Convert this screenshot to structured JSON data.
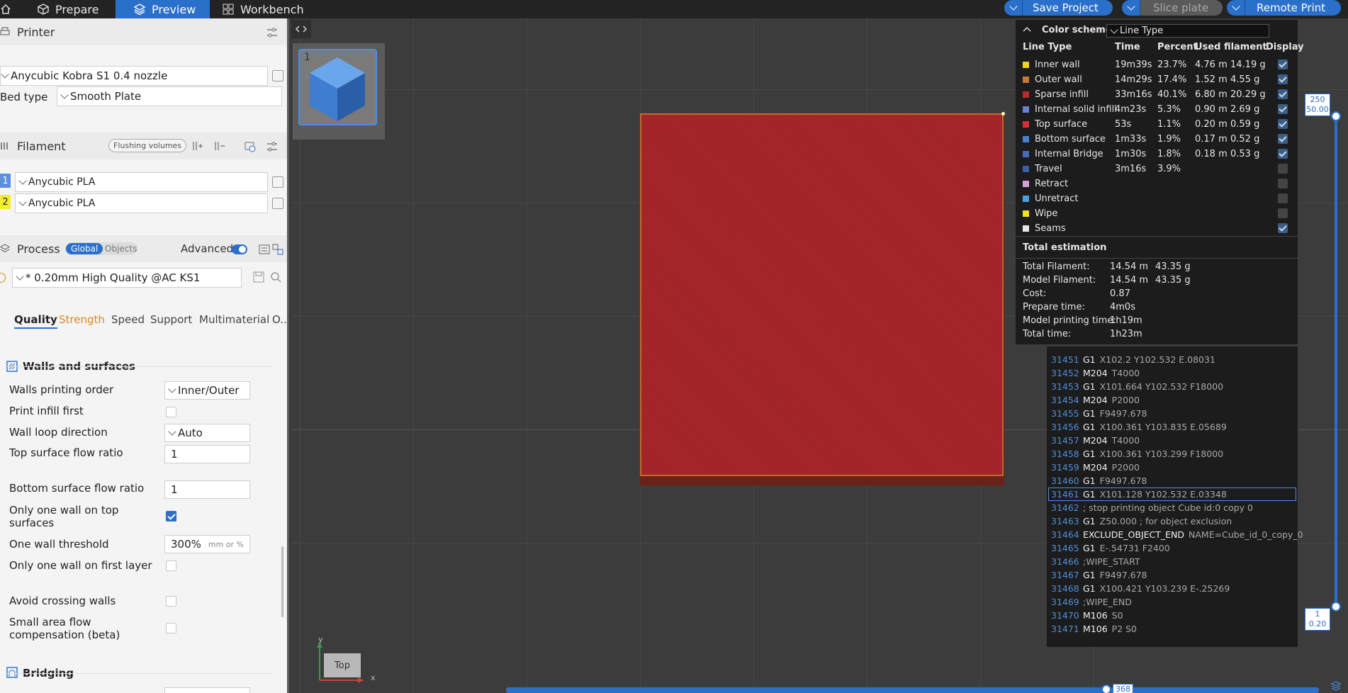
{
  "topbar": {
    "tabs": [
      {
        "label": "Prepare",
        "icon": "cube-outline-icon"
      },
      {
        "label": "Preview",
        "icon": "layers-icon",
        "active": true
      },
      {
        "label": "Workbench",
        "icon": "grid-icon"
      }
    ],
    "save_project": "Save Project",
    "slice_plate": "Slice plate",
    "remote_print": "Remote Print"
  },
  "printer": {
    "section": "Printer",
    "name": "Anycubic Kobra S1 0.4 nozzle",
    "bed_type_label": "Bed type",
    "bed_type": "Smooth Plate"
  },
  "filament": {
    "section": "Filament",
    "flushing": "Flushing volumes",
    "items": [
      {
        "index": "1",
        "name": "Anycubic PLA",
        "color": "#5b8fe0"
      },
      {
        "index": "2",
        "name": "Anycubic PLA",
        "color": "#f2ee2c"
      }
    ]
  },
  "process": {
    "section": "Process",
    "global": "Global",
    "objects": "Objects",
    "advanced": "Advanced",
    "preset": "* 0.20mm High Quality @AC KS1",
    "tabs": [
      "Quality",
      "Strength",
      "Speed",
      "Support",
      "Multimaterial",
      "O..."
    ],
    "group_walls": "Walls and surfaces",
    "settings": {
      "walls_printing_order": {
        "label": "Walls printing order",
        "value": "Inner/Outer"
      },
      "print_infill_first": {
        "label": "Print infill first",
        "checked": false
      },
      "wall_loop_direction": {
        "label": "Wall loop direction",
        "value": "Auto"
      },
      "top_surface_flow_ratio": {
        "label": "Top surface flow ratio",
        "value": "1"
      },
      "bottom_surface_flow_ratio": {
        "label": "Bottom surface flow ratio",
        "value": "1"
      },
      "only_one_wall_top": {
        "label1": "Only one wall on top",
        "label2": "surfaces",
        "checked": true
      },
      "one_wall_threshold": {
        "label": "One wall threshold",
        "value": "300%",
        "unit": "mm or %"
      },
      "only_one_wall_first": {
        "label": "Only one wall on first layer",
        "checked": false
      },
      "avoid_crossing_walls": {
        "label": "Avoid crossing walls",
        "checked": false
      },
      "small_area_flow": {
        "label1": "Small area flow",
        "label2": "compensation (beta)",
        "checked": false
      }
    },
    "group_bridging": "Bridging"
  },
  "viewport": {
    "plate_number": "1",
    "view_cube_label": "Top",
    "axis_x": "x",
    "axis_y": "y",
    "layer_top": {
      "layer": "250",
      "height": "50.00"
    },
    "layer_bottom": {
      "layer": "1",
      "height": "0.20"
    },
    "horizontal_slider_value": "368",
    "model_color": "#a8262a"
  },
  "legend": {
    "color_scheme_label": "Color scheme",
    "color_scheme_value": "Line Type",
    "headers": [
      "Line Type",
      "Time",
      "Percent",
      "Used filament",
      "Display"
    ],
    "rows": [
      {
        "name": "Inner wall",
        "color": "#f0d020",
        "time": "19m39s",
        "percent": "23.7%",
        "length": "4.76 m",
        "weight": "14.19 g",
        "display": true
      },
      {
        "name": "Outer wall",
        "color": "#c8783a",
        "time": "14m29s",
        "percent": "17.4%",
        "length": "1.52 m",
        "weight": "4.55 g",
        "display": true
      },
      {
        "name": "Sparse infill",
        "color": "#b82c2c",
        "time": "33m16s",
        "percent": "40.1%",
        "length": "6.80 m",
        "weight": "20.29 g",
        "display": true
      },
      {
        "name": "Internal solid infill",
        "color": "#6a7ed8",
        "time": "4m23s",
        "percent": "5.3%",
        "length": "0.90 m",
        "weight": "2.69 g",
        "display": true
      },
      {
        "name": "Top surface",
        "color": "#d83030",
        "time": "53s",
        "percent": "1.1%",
        "length": "0.20 m",
        "weight": "0.59 g",
        "display": true
      },
      {
        "name": "Bottom surface",
        "color": "#4c7fd0",
        "time": "1m33s",
        "percent": "1.9%",
        "length": "0.17 m",
        "weight": "0.52 g",
        "display": true
      },
      {
        "name": "Internal Bridge",
        "color": "#4a6ab8",
        "time": "1m30s",
        "percent": "1.8%",
        "length": "0.18 m",
        "weight": "0.53 g",
        "display": true
      },
      {
        "name": "Travel",
        "color": "#3c5ea8",
        "time": "3m16s",
        "percent": "3.9%",
        "length": "",
        "weight": "",
        "display": false
      },
      {
        "name": "Retract",
        "color": "#d8a0d8",
        "time": "",
        "percent": "",
        "length": "",
        "weight": "",
        "display": false
      },
      {
        "name": "Unretract",
        "color": "#4aa0e0",
        "time": "",
        "percent": "",
        "length": "",
        "weight": "",
        "display": false
      },
      {
        "name": "Wipe",
        "color": "#f0e020",
        "time": "",
        "percent": "",
        "length": "",
        "weight": "",
        "display": false
      },
      {
        "name": "Seams",
        "color": "#e8e8e8",
        "time": "",
        "percent": "",
        "length": "",
        "weight": "",
        "display": true
      }
    ],
    "total_title": "Total estimation",
    "totals": [
      {
        "label": "Total Filament:",
        "v1": "14.54 m",
        "v2": "43.35 g"
      },
      {
        "label": "Model Filament:",
        "v1": "14.54 m",
        "v2": "43.35 g"
      },
      {
        "label": "Cost:",
        "v1": "0.87",
        "v2": ""
      },
      {
        "label": "Prepare time:",
        "v1": "4m0s",
        "v2": ""
      },
      {
        "label": "Model printing time:",
        "v1": "1h19m",
        "v2": ""
      },
      {
        "label": "Total time:",
        "v1": "1h23m",
        "v2": ""
      }
    ]
  },
  "gcode": {
    "selected_line": "31461",
    "lines": [
      {
        "n": "31451",
        "cmd": "G1",
        "args": "X102.2 Y102.532 E.08031"
      },
      {
        "n": "31452",
        "cmd": "M204",
        "args": "T4000"
      },
      {
        "n": "31453",
        "cmd": "G1",
        "args": "X101.664 Y102.532 F18000"
      },
      {
        "n": "31454",
        "cmd": "M204",
        "args": "P2000"
      },
      {
        "n": "31455",
        "cmd": "G1",
        "args": "F9497.678"
      },
      {
        "n": "31456",
        "cmd": "G1",
        "args": "X100.361 Y103.835 E.05689"
      },
      {
        "n": "31457",
        "cmd": "M204",
        "args": "T4000"
      },
      {
        "n": "31458",
        "cmd": "G1",
        "args": "X100.361 Y103.299 F18000"
      },
      {
        "n": "31459",
        "cmd": "M204",
        "args": "P2000"
      },
      {
        "n": "31460",
        "cmd": "G1",
        "args": "F9497.678"
      },
      {
        "n": "31461",
        "cmd": "G1",
        "args": "X101.128 Y102.532 E.03348"
      },
      {
        "n": "31462",
        "cmd": "",
        "args": "; stop printing object Cube id:0 copy 0"
      },
      {
        "n": "31463",
        "cmd": "G1",
        "args": "Z50.000 ; for object exclusion"
      },
      {
        "n": "31464",
        "cmd": "EXCLUDE_OBJECT_END",
        "args": "NAME=Cube_id_0_copy_0"
      },
      {
        "n": "31465",
        "cmd": "G1",
        "args": "E-.54731 F2400"
      },
      {
        "n": "31466",
        "cmd": "",
        "args": ";WIPE_START"
      },
      {
        "n": "31467",
        "cmd": "G1",
        "args": "F9497.678"
      },
      {
        "n": "31468",
        "cmd": "G1",
        "args": "X100.421 Y103.239 E-.25269"
      },
      {
        "n": "31469",
        "cmd": "",
        "args": ";WIPE_END"
      },
      {
        "n": "31470",
        "cmd": "M106",
        "args": "S0"
      },
      {
        "n": "31471",
        "cmd": "M106",
        "args": "P2 S0"
      }
    ]
  }
}
